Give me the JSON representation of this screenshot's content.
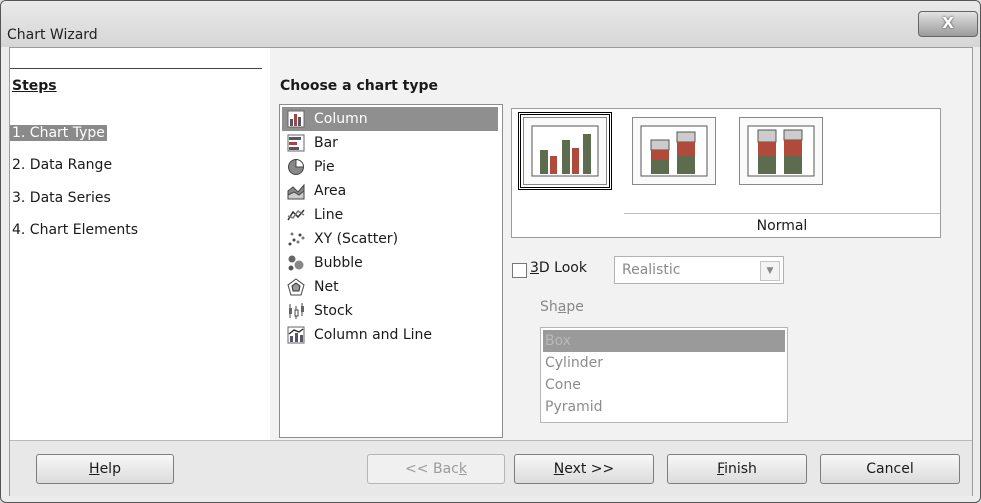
{
  "window": {
    "title": "Chart Wizard",
    "close_glyph": "X"
  },
  "steps": {
    "heading": "Steps",
    "items": [
      "1. Chart Type",
      "2. Data Range",
      "3. Data Series",
      "4. Chart Elements"
    ],
    "selected_index": 0
  },
  "chart_type": {
    "heading": "Choose a chart type",
    "types": [
      {
        "label": "Column",
        "icon": "column-chart-icon"
      },
      {
        "label": "Bar",
        "icon": "bar-chart-icon"
      },
      {
        "label": "Pie",
        "icon": "pie-chart-icon"
      },
      {
        "label": "Area",
        "icon": "area-chart-icon"
      },
      {
        "label": "Line",
        "icon": "line-chart-icon"
      },
      {
        "label": "XY (Scatter)",
        "icon": "scatter-chart-icon"
      },
      {
        "label": "Bubble",
        "icon": "bubble-chart-icon"
      },
      {
        "label": "Net",
        "icon": "net-chart-icon"
      },
      {
        "label": "Stock",
        "icon": "stock-chart-icon"
      },
      {
        "label": "Column and Line",
        "icon": "column-and-line-chart-icon"
      }
    ],
    "selected_index": 0
  },
  "variants": {
    "selected_label": "Normal",
    "items": [
      "normal-column-variant-icon",
      "stacked-column-variant-icon",
      "percent-stacked-column-variant-icon"
    ],
    "selected_index": 0
  },
  "options": {
    "look_3d": {
      "prefix": "",
      "mnemonic": "3",
      "suffix": "D Look",
      "checked": false
    },
    "look_style": "Realistic",
    "shape": {
      "prefix": "Sh",
      "mnemonic": "a",
      "suffix": "pe"
    },
    "shapes": [
      "Box",
      "Cylinder",
      "Cone",
      "Pyramid"
    ],
    "selected_shape_index": 0
  },
  "buttons": {
    "help": {
      "mnemonic": "H",
      "rest": "elp"
    },
    "back": {
      "prefix": "<< Bac",
      "mnemonic": "k"
    },
    "next": {
      "mnemonic": "N",
      "rest": "ext >>"
    },
    "finish": {
      "mnemonic": "F",
      "rest": "inish"
    },
    "cancel": "Cancel"
  },
  "colors": {
    "selection": "#8f8f8f",
    "bar_dark": "#5d6b4f",
    "bar_red": "#b04a3b"
  }
}
